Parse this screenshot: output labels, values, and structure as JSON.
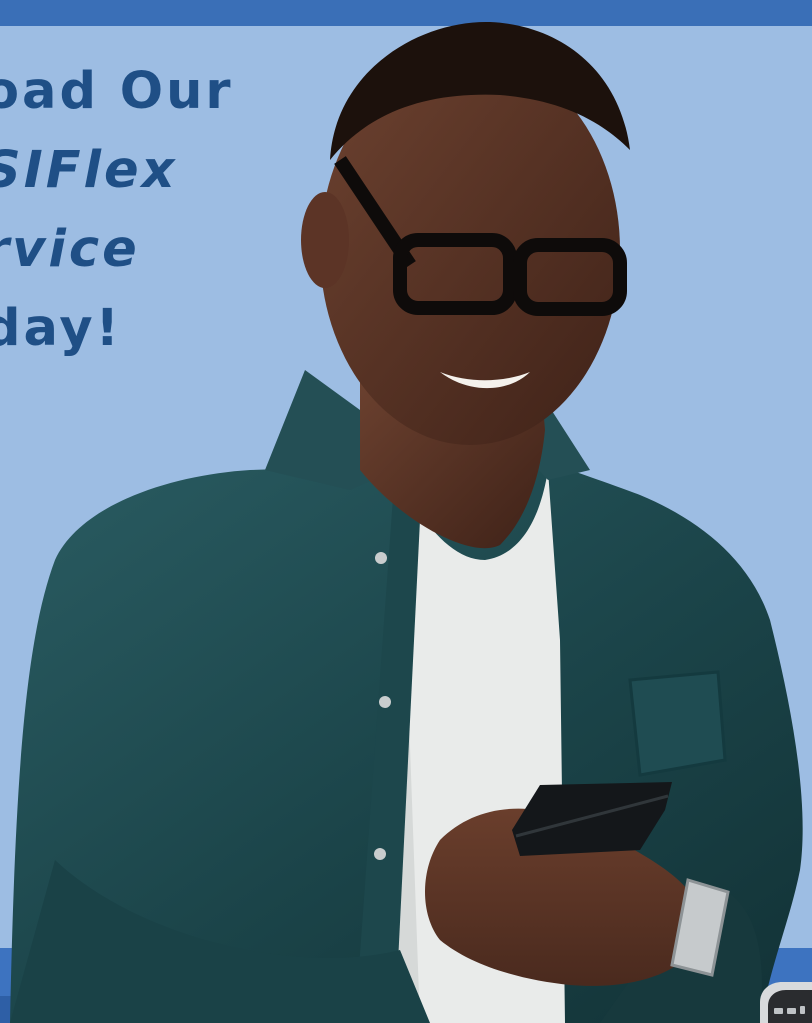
{
  "promo": {
    "line1": "oad Our",
    "line2": "SIFlex",
    "line3": "rvice",
    "line4": "day!"
  },
  "colors": {
    "background": "#9dbde3",
    "top_bar": "#3a6fb7",
    "bottom_band": "#3d73c0",
    "headline": "#1f4f86",
    "shirt": "#1e4a4f",
    "tshirt": "#e9ebea",
    "skin": "#5a3424"
  },
  "icons": {
    "phone_status_icons": "phone-status-icons"
  }
}
